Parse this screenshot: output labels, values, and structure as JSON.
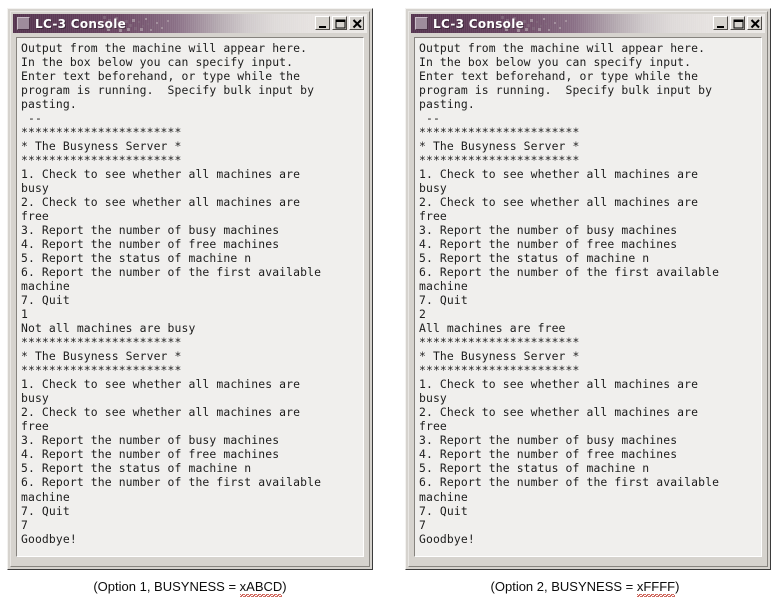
{
  "window": {
    "title": "LC-3 Console",
    "sys_icon": "window-system-menu-icon",
    "buttons": {
      "minimize": "minimize-button",
      "maximize": "maximize-button",
      "close": "close-button"
    }
  },
  "colors": {
    "titlebar_start": "#55344f",
    "titlebar_end": "#eceae7",
    "title_text": "#ffffff",
    "window_face": "#d6d3ce",
    "console_bg": "#f0efed",
    "console_text": "#1c1c1c",
    "spellcheck_underline": "#c0392b"
  },
  "panels": [
    {
      "id": "option-1",
      "caption_prefix": "(Option 1, BUSYNESS = ",
      "caption_value": "xABCD",
      "caption_suffix": ")",
      "console_lines": [
        "Output from the machine will appear here.",
        "In the box below you can specify input.",
        "Enter text beforehand, or type while the",
        "program is running.  Specify bulk input by",
        "pasting.",
        " --",
        "***********************",
        "* The Busyness Server *",
        "***********************",
        "1. Check to see whether all machines are",
        "busy",
        "2. Check to see whether all machines are",
        "free",
        "3. Report the number of busy machines",
        "4. Report the number of free machines",
        "5. Report the status of machine n",
        "6. Report the number of the first available",
        "machine",
        "7. Quit",
        "1",
        "Not all machines are busy",
        "***********************",
        "* The Busyness Server *",
        "***********************",
        "1. Check to see whether all machines are",
        "busy",
        "2. Check to see whether all machines are",
        "free",
        "3. Report the number of busy machines",
        "4. Report the number of free machines",
        "5. Report the status of machine n",
        "6. Report the number of the first available",
        "machine",
        "7. Quit",
        "7",
        "Goodbye!"
      ]
    },
    {
      "id": "option-2",
      "caption_prefix": "(Option 2, BUSYNESS = ",
      "caption_value": "xFFFF",
      "caption_suffix": ")",
      "console_lines": [
        "Output from the machine will appear here.",
        "In the box below you can specify input.",
        "Enter text beforehand, or type while the",
        "program is running.  Specify bulk input by",
        "pasting.",
        " --",
        "***********************",
        "* The Busyness Server *",
        "***********************",
        "1. Check to see whether all machines are",
        "busy",
        "2. Check to see whether all machines are",
        "free",
        "3. Report the number of busy machines",
        "4. Report the number of free machines",
        "5. Report the status of machine n",
        "6. Report the number of the first available",
        "machine",
        "7. Quit",
        "2",
        "All machines are free",
        "***********************",
        "* The Busyness Server *",
        "***********************",
        "1. Check to see whether all machines are",
        "busy",
        "2. Check to see whether all machines are",
        "free",
        "3. Report the number of busy machines",
        "4. Report the number of free machines",
        "5. Report the status of machine n",
        "6. Report the number of the first available",
        "machine",
        "7. Quit",
        "7",
        "Goodbye!"
      ]
    }
  ]
}
